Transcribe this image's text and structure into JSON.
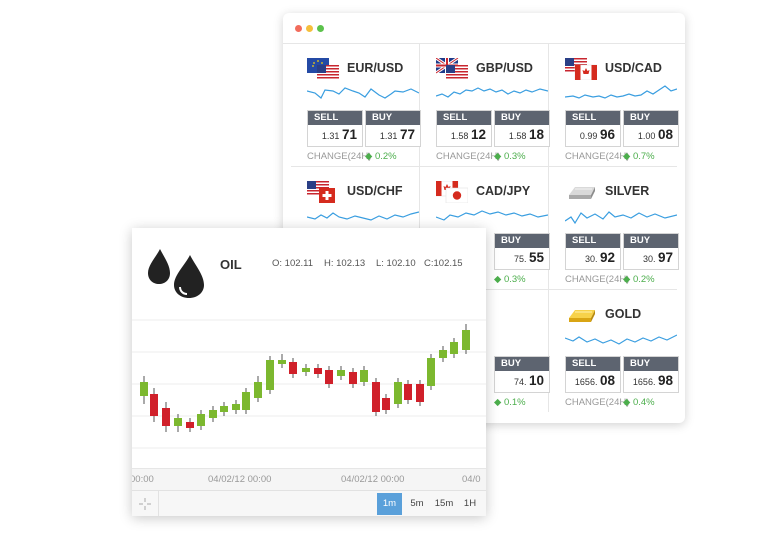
{
  "window": {
    "dots": [
      "#f26c5c",
      "#f5bf3c",
      "#5cc24c"
    ]
  },
  "tiles": [
    {
      "symbol": "EUR/USD",
      "icon": "eur-usd-flag-icon",
      "sell_label": "SELL",
      "buy_label": "BUY",
      "sell_small": "1.31",
      "sell_big": "71",
      "buy_small": "1.31",
      "buy_big": "77",
      "change_label": "CHANGE(24H)",
      "change": "0.2%"
    },
    {
      "symbol": "GBP/USD",
      "icon": "gbp-usd-flag-icon",
      "sell_label": "SELL",
      "buy_label": "BUY",
      "sell_small": "1.58",
      "sell_big": "12",
      "buy_small": "1.58",
      "buy_big": "18",
      "change_label": "CHANGE(24H)",
      "change": "0.3%"
    },
    {
      "symbol": "USD/CAD",
      "icon": "usd-cad-flag-icon",
      "sell_label": "SELL",
      "buy_label": "BUY",
      "sell_small": "0.99",
      "sell_big": "96",
      "buy_small": "1.00",
      "buy_big": "08",
      "change_label": "CHANGE(24H)",
      "change": "0.7%"
    },
    {
      "symbol": "USD/CHF",
      "icon": "usd-chf-flag-icon"
    },
    {
      "symbol": "CAD/JPY",
      "icon": "cad-jpy-flag-icon",
      "buy_label": "BUY",
      "buy_small": "75.",
      "buy_big": "55",
      "change": "0.3%"
    },
    {
      "symbol": "SILVER",
      "icon": "silver-bar-icon",
      "sell_label": "SELL",
      "buy_label": "BUY",
      "sell_small": "30.",
      "sell_big": "92",
      "buy_small": "30.",
      "buy_big": "97",
      "change_label": "CHANGE(24H)",
      "change": "0.2%"
    },
    {
      "symbol": "",
      "icon": ""
    },
    {
      "symbol": "",
      "icon": "",
      "buy_label": "BUY",
      "buy_small": "74.",
      "buy_big": "10",
      "change": "0.1%"
    },
    {
      "symbol": "GOLD",
      "icon": "gold-bar-icon",
      "sell_label": "SELL",
      "buy_label": "BUY",
      "sell_small": "1656.",
      "sell_big": "08",
      "buy_small": "1656.",
      "buy_big": "98",
      "change_label": "CHANGE(24H)",
      "change": "0.4%"
    }
  ],
  "oil": {
    "name": "OIL",
    "icon": "oil-drops-icon",
    "open": "O: 102.11",
    "high": "H: 102.13",
    "low": "L: 102.10",
    "close": "C:102.15",
    "x_labels": [
      "00:00",
      "04/02/12 00:00",
      "04/02/12 00:00",
      "04/0"
    ],
    "timeframes": [
      "1m",
      "5m",
      "15m",
      "1H"
    ],
    "active_timeframe": "1m",
    "colors": {
      "up": "#7cb82f",
      "down": "#d0202a"
    }
  }
}
